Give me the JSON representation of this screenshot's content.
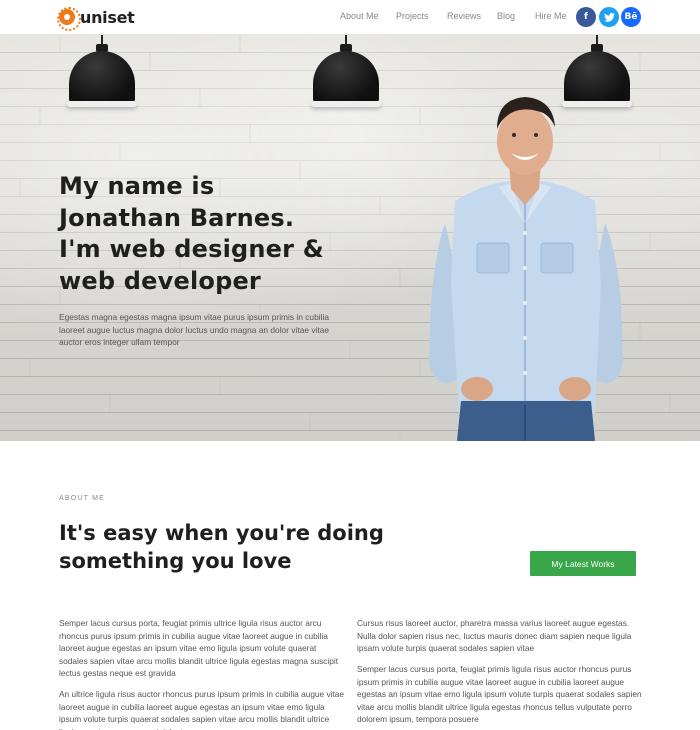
{
  "header": {
    "logo_text": "uniset",
    "nav": [
      "About Me",
      "Projects",
      "Reviews",
      "Blog",
      "Hire Me"
    ],
    "social": [
      {
        "name": "facebook",
        "glyph": "f",
        "color": "#3b5998"
      },
      {
        "name": "twitter",
        "glyph": "t",
        "color": "#1da1f2"
      },
      {
        "name": "behance",
        "glyph": "Bē",
        "color": "#1769ff"
      }
    ]
  },
  "hero": {
    "title_lines": [
      "My name is",
      "Jonathan Barnes.",
      "I'm web designer &",
      "web developer"
    ],
    "description": "Egestas magna egestas magna ipsum vitae purus ipsum primis in cubilia laoreet augue luctus magna dolor luctus undo magna an dolor vitae vitae auctor eros integer ullam tempor"
  },
  "about": {
    "label": "ABOUT ME",
    "title_lines": [
      "It's easy when you're doing",
      "something you love"
    ],
    "cta_label": "My Latest Works",
    "cta_color": "#3aa64a",
    "left_paragraphs": [
      "Semper lacus cursus porta, feugiat primis ultrice ligula risus auctor arcu rhoncus purus ipsum primis in cubilia augue vitae laoreet augue in cubilia laoreet augue egestas an ipsum vitae emo ligula ipsum volute quaerat sodales sapien vitae arcu mollis blandit ultrice ligula egestas magna suscipit lectus gestas neque est gravida",
      "An ultrice ligula risus auctor rhoncus purus ipsum primis in cubilia augue vitae laoreet augue in cubilia laoreet augue egestas an ipsum vitae emo ligula ipsum volute turpis quaerat sodales sapien vitae arcu mollis blandit ultrice ligula egestas magna suscipit lectus"
    ],
    "right_paragraphs": [
      "Cursus risus laoreet auctor, pharetra massa varius laoreet augue egestas. Nulla dolor sapien risus nec, luctus mauris donec diam sapien neque ligula ipsam volute turpis quaerat sodales sapien vitae",
      "Semper lacus cursus porta, feugiat primis ligula risus auctor rhoncus purus ipsum primis in cubilia augue vitae laoreet augue in cubilia laoreet augue egestas an ipsum vitae emo ligula ipsum volute turpis quaerat sodales sapien vitae arcu mollis blandit ultrice ligula egestas rhoncus tellus vulputate porro dolorem ipsum, tempora posuere"
    ]
  }
}
